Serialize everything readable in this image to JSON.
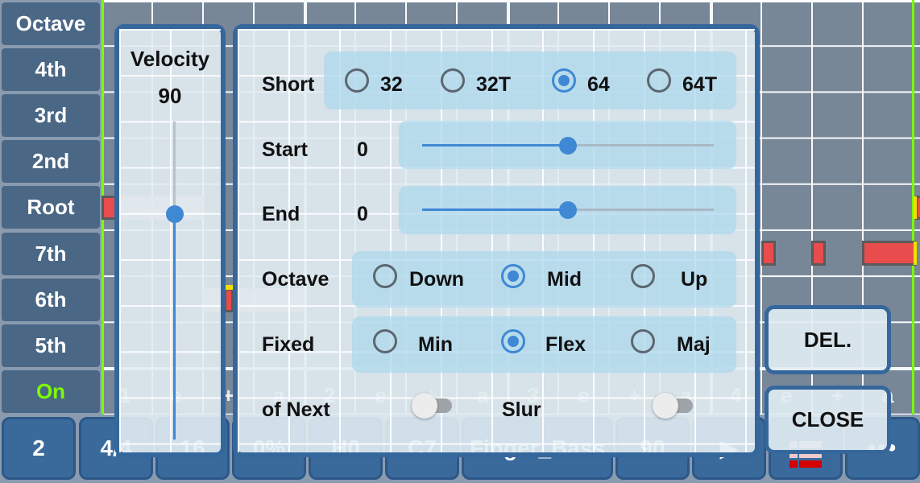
{
  "row_labels": [
    "Octave",
    "4th",
    "3rd",
    "2nd",
    "Root",
    "7th",
    "6th",
    "5th",
    "On"
  ],
  "beat_labels": [
    "1",
    "e",
    "+",
    "a",
    "2",
    "e",
    "+",
    "a",
    "3",
    "e",
    "+",
    "a",
    "4",
    "e",
    "+",
    "a"
  ],
  "toolbar": {
    "buttons": [
      {
        "label": "2",
        "icon": null
      },
      {
        "label": "4/4",
        "icon": null
      },
      {
        "label": "16",
        "icon": null
      },
      {
        "label": "0%",
        "icon": null
      },
      {
        "label": "H0",
        "icon": null
      },
      {
        "label": "C7",
        "icon": null
      },
      {
        "label": "Finger_Bass",
        "icon": null
      },
      {
        "label": "90",
        "icon": null
      },
      {
        "label": "",
        "icon": "play-icon"
      },
      {
        "label": "",
        "icon": "piano-roll-icon"
      },
      {
        "label": "",
        "icon": "more-icon"
      }
    ]
  },
  "velocity": {
    "title": "Velocity",
    "value": "90",
    "fraction": 0.71
  },
  "editor": {
    "short": {
      "label": "Short",
      "options": [
        "32",
        "32T",
        "64",
        "64T"
      ],
      "selected": "64"
    },
    "start": {
      "label": "Start",
      "value": "0",
      "fraction": 0.5
    },
    "end": {
      "label": "End",
      "value": "0",
      "fraction": 0.5
    },
    "octave": {
      "label": "Octave",
      "options": [
        "Down",
        "Mid",
        "Up"
      ],
      "selected": "Mid"
    },
    "fixed": {
      "label": "Fixed",
      "options": [
        "Min",
        "Flex",
        "Maj"
      ],
      "selected": "Flex"
    },
    "of_next": {
      "label": "of Next",
      "on": false
    },
    "slur": {
      "label": "Slur",
      "on": false
    }
  },
  "actions": {
    "delete_label": "DEL.",
    "close_label": "CLOSE"
  },
  "colors": {
    "accent": "#3f88d4",
    "panel_border": "#35679c",
    "playhead": "#7cfc00",
    "note": "#e84c4c"
  }
}
